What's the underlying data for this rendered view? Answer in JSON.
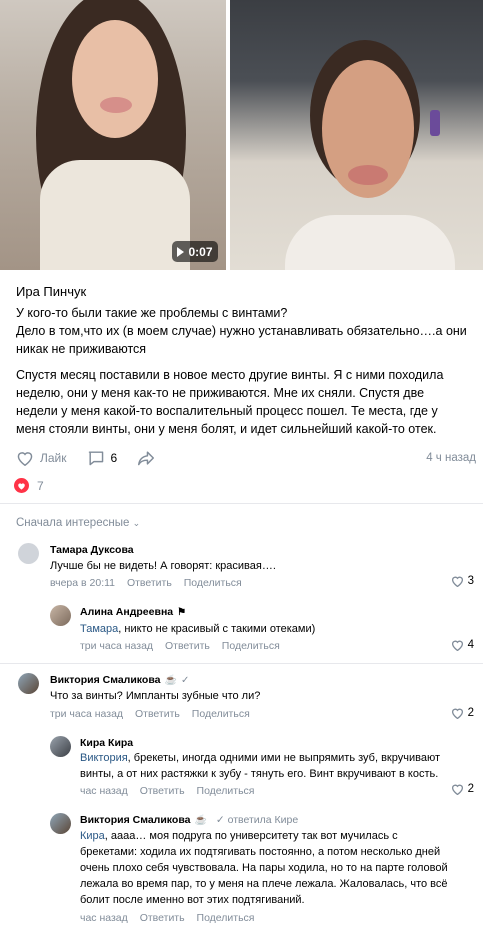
{
  "media": {
    "duration": "0:07"
  },
  "post": {
    "author": "Ира Пинчук",
    "line1": "У кого-то были такие же проблемы с винтами?",
    "line2": "Дело в том,что их (в моем случае) нужно устанавливать обязательно….а они",
    "line3": "никак не приживаются",
    "para2_l1": "Спустя месяц поставили в новое место другие винты. Я с ними походила",
    "para2_l2": "неделю, они у меня как-то не приживаются. Мне их сняли. Спустя две",
    "para2_l3": "недели у меня какой-то воспалительный процесс пошел. Те места, где у",
    "para2_l4": "меня стояли винты, они у меня болят, и идет сильнейший какой-то отек.",
    "like_label": "Лайк",
    "comments_count": "6",
    "time": "4 ч назад",
    "reactions_count": "7"
  },
  "sort_label": "Сначала интересные",
  "comments": [
    {
      "name": "Тамара Дуксова",
      "text": "Лучше бы не видеть! А говорят: красивая….",
      "time": "вчера в 20:11",
      "reply": "Ответить",
      "share": "Поделиться",
      "likes": "3"
    },
    {
      "name": "Алина Андреевна",
      "mention": "Тамара",
      "text": ", никто не красивый с такими отеками)",
      "time": "три часа назад",
      "reply": "Ответить",
      "share": "Поделиться",
      "likes": "4"
    },
    {
      "name": "Виктория Смаликова",
      "text": "Что за винты? Импланты зубные что ли?",
      "time": "три часа назад",
      "reply": "Ответить",
      "share": "Поделиться",
      "likes": "2"
    },
    {
      "name": "Кира Кира",
      "mention": "Виктория",
      "text_l1": ", брекеты, иногда одними ими не выпрямить зуб, вкручивают",
      "text_l2": "винты, а от них растяжки к зубу - тянуть его. Винт вкручивают в кость.",
      "time": "час назад",
      "reply": "Ответить",
      "share": "Поделиться",
      "likes": "2"
    },
    {
      "name": "Виктория Смаликова",
      "replied_to": "ответила Кире",
      "mention": "Кира",
      "text_l1": ", аааа… моя подруга по университету так вот мучилась с",
      "text_l2": "брекетами: ходила их подтягивать постоянно, а потом несколько дней",
      "text_l3": "очень плохо себя чувствовала. На пары ходила, но то на парте головой",
      "text_l4": "лежала во время пар, то у меня на плече лежала. Жаловалась, что всё",
      "text_l5": "болит после именно вот этих подтягиваний.",
      "time": "час назад",
      "reply": "Ответить",
      "share": "Поделиться"
    }
  ],
  "colors": {
    "link": "#2a5885",
    "muted": "#818c99",
    "heart": "#ff3347"
  }
}
